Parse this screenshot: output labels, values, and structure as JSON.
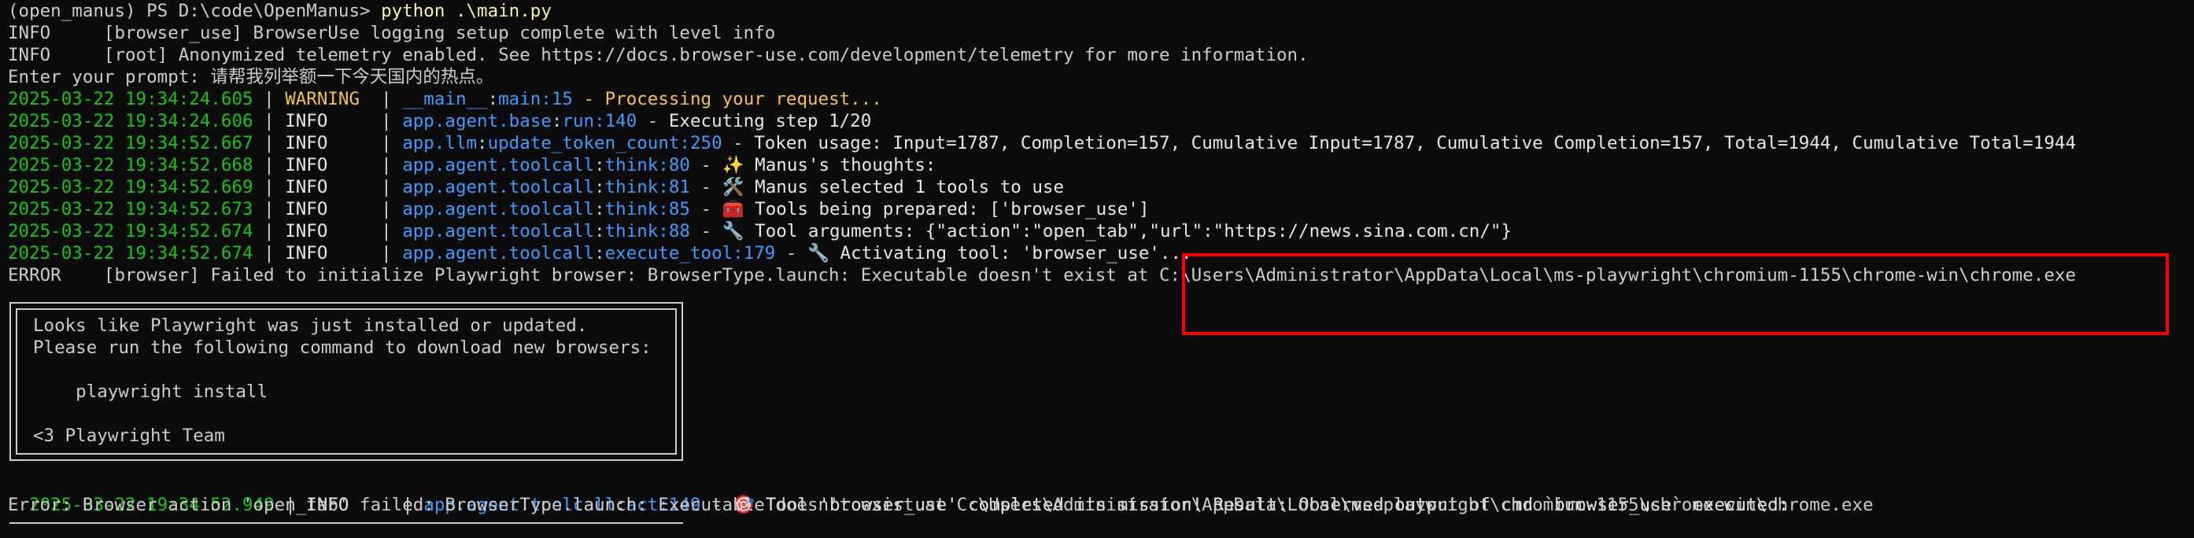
{
  "terminal": {
    "prompt": "(open_manus) PS D:\\code\\OpenManus> ",
    "command": "python .\\main.py",
    "info1": "INFO     [browser_use] BrowserUse logging setup complete with level info",
    "info2": "INFO     [root] Anonymized telemetry enabled. See https://docs.browser-use.com/development/telemetry for more information.",
    "enter_prompt": "Enter your prompt: 请帮我列举额一下今天国内的热点。",
    "log_lines": [
      {
        "ts": "2025-03-22 19:34:24.605",
        "sep": " | ",
        "level": "WARNING ",
        "sep2": " | ",
        "module": "__main__",
        "colon": ":",
        "func": "main",
        "line": ":15",
        "dash": " - ",
        "msg": "Processing your request..."
      },
      {
        "ts": "2025-03-22 19:34:24.606",
        "sep": " | ",
        "level": "INFO    ",
        "sep2": " | ",
        "module": "app.agent.base",
        "colon": ":",
        "func": "run",
        "line": ":140",
        "dash": " - ",
        "msg": "Executing step 1/20"
      },
      {
        "ts": "2025-03-22 19:34:52.667",
        "sep": " | ",
        "level": "INFO    ",
        "sep2": " | ",
        "module": "app.llm",
        "colon": ":",
        "func": "update_token_count",
        "line": ":250",
        "dash": " - ",
        "msg": "Token usage: Input=1787, Completion=157, Cumulative Input=1787, Cumulative Completion=157, Total=1944, Cumulative Total=1944"
      },
      {
        "ts": "2025-03-22 19:34:52.668",
        "sep": " | ",
        "level": "INFO    ",
        "sep2": " | ",
        "module": "app.agent.toolcall",
        "colon": ":",
        "func": "think",
        "line": ":80",
        "dash": " - ",
        "msg": "✨ Manus's thoughts:"
      },
      {
        "ts": "2025-03-22 19:34:52.669",
        "sep": " | ",
        "level": "INFO    ",
        "sep2": " | ",
        "module": "app.agent.toolcall",
        "colon": ":",
        "func": "think",
        "line": ":81",
        "dash": " - ",
        "msg": "🛠️ Manus selected 1 tools to use"
      },
      {
        "ts": "2025-03-22 19:34:52.673",
        "sep": " | ",
        "level": "INFO    ",
        "sep2": " | ",
        "module": "app.agent.toolcall",
        "colon": ":",
        "func": "think",
        "line": ":85",
        "dash": " - ",
        "msg": "🧰 Tools being prepared: ['browser_use']"
      },
      {
        "ts": "2025-03-22 19:34:52.674",
        "sep": " | ",
        "level": "INFO    ",
        "sep2": " | ",
        "module": "app.agent.toolcall",
        "colon": ":",
        "func": "think",
        "line": ":88",
        "dash": " - ",
        "msg": "🔧 Tool arguments: {\"action\":\"open_tab\",\"url\":\"https://news.sina.com.cn/\"}"
      },
      {
        "ts": "2025-03-22 19:34:52.674",
        "sep": " | ",
        "level": "INFO    ",
        "sep2": " | ",
        "module": "app.agent.toolcall",
        "colon": ":",
        "func": "execute_tool",
        "line": ":179",
        "dash": " - ",
        "msg": "🔧 Activating tool: 'browser_use'..."
      }
    ],
    "error_line": "ERROR    [browser] Failed to initialize Playwright browser: BrowserType.launch: Executable doesn't exist at C:\\Users\\Administrator\\AppData\\Local\\ms-playwright\\chromium-1155\\chrome-win\\chrome.exe",
    "box": {
      "l1": "Looks like Playwright was just installed or updated.",
      "l2": "Please run the following command to download new browsers:",
      "l3": "    playwright install",
      "l4": "<3 Playwright Team"
    },
    "final_log": {
      "ts": "2025-03-22 19:34:52.949",
      "sep": " | ",
      "level": "INFO    ",
      "sep2": " | ",
      "module": "app.agent.toolcall",
      "colon": ":",
      "func": "act",
      "line": ":149",
      "dash": " - ",
      "msg": "🎯 Tool 'browser_use' completed its mission! Result: Observed output of cmd `browser_use` executed:"
    },
    "final_error": "Error: Browser action 'open_tab' failed: BrowserType.launch: Executable doesn't exist at C:\\Users\\Administrator\\AppData\\Local\\ms-playwright\\chromium-1155\\chrome-win\\chrome.exe"
  },
  "colors": {
    "background": "#0c0c0c",
    "timestamp": "#16c60c",
    "module": "#3b9cff",
    "warning": "#f2c14e",
    "highlight": "#ff0000"
  }
}
